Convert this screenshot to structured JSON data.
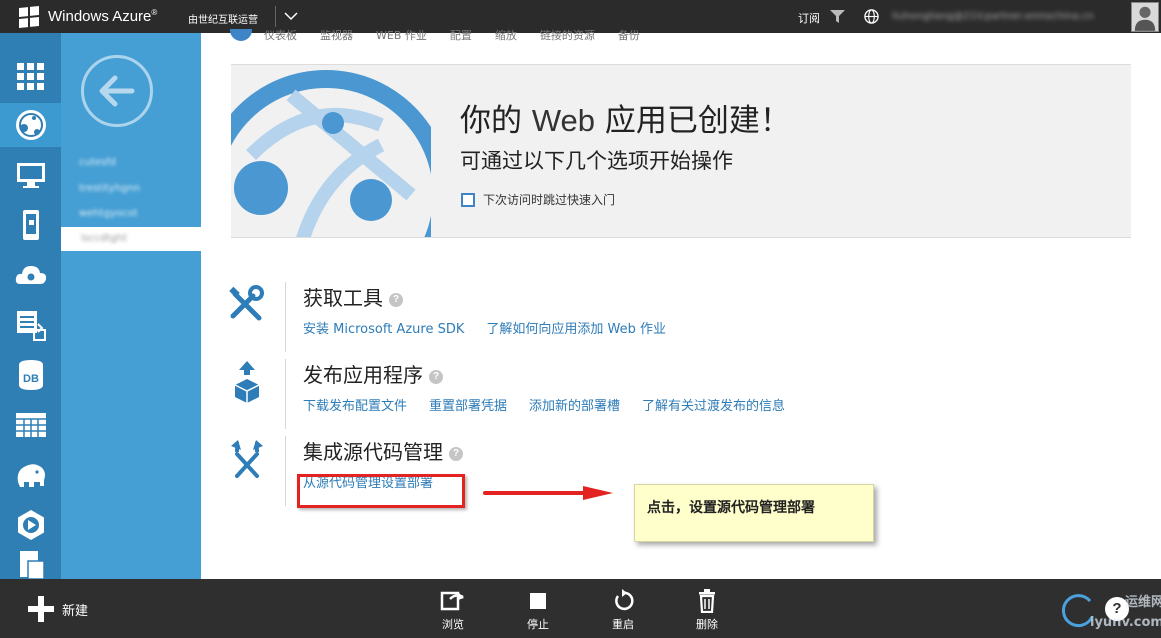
{
  "topbar": {
    "brand": "Windows Azure",
    "brand_mark": "®",
    "operator": "由世纪互联运营",
    "subscribe": "订阅",
    "account": "liuhongliang@21V.partner.onmschina.cn"
  },
  "leftnav": {
    "items": [
      {
        "icon": "all-items-grid-icon"
      },
      {
        "icon": "web-sites-icon",
        "active": true
      },
      {
        "icon": "virtual-machines-icon"
      },
      {
        "icon": "mobile-services-icon"
      },
      {
        "icon": "cloud-services-icon"
      },
      {
        "icon": "batch-service-icon"
      },
      {
        "icon": "sql-database-icon",
        "text": "DB"
      },
      {
        "icon": "storage-icon"
      },
      {
        "icon": "hdinsight-icon"
      },
      {
        "icon": "media-services-icon"
      },
      {
        "icon": "more-services-icon"
      }
    ]
  },
  "secnav": {
    "items": [
      "cutesfd",
      "trestityhgnn",
      "wehtgyocot"
    ],
    "selected": "lsccdtght"
  },
  "tabs": [
    "仪表板",
    "监视器",
    "WEB 作业",
    "配置",
    "缩放",
    "链接的资源",
    "备份"
  ],
  "hero": {
    "title_pre": "你的",
    "title_web": "Web",
    "title_post": "应用已创建！",
    "subtitle": "可通过以下几个选项开始操作",
    "skip_label": "下次访问时跳过快速入门"
  },
  "sections": [
    {
      "title": "获取工具",
      "icon": "tools-icon",
      "links": [
        "安装 Microsoft Azure SDK",
        "了解如何向应用添加 Web 作业"
      ]
    },
    {
      "title": "发布应用程序",
      "icon": "publish-icon",
      "links": [
        "下载发布配置文件",
        "重置部署凭据",
        "添加新的部署槽",
        "了解有关过渡发布的信息"
      ]
    },
    {
      "title": "集成源代码管理",
      "icon": "source-control-icon",
      "links": [
        "从源代码管理设置部署"
      ]
    }
  ],
  "help_glyph": "?",
  "annotation": {
    "note": "点击，设置源代码管理部署"
  },
  "bottombar": {
    "new_label": "新建",
    "commands": [
      {
        "label": "浏览",
        "icon": "browse-icon"
      },
      {
        "label": "停止",
        "icon": "stop-icon"
      },
      {
        "label": "重启",
        "icon": "restart-icon"
      },
      {
        "label": "删除",
        "icon": "delete-icon"
      }
    ],
    "help": "?",
    "watermark_top": "运维网",
    "watermark_bottom": "iyunv.com"
  },
  "colors": {
    "accent": "#2f7fb4",
    "secondary": "#469fd4",
    "link": "#2e7cb8",
    "annotation_red": "#e32222",
    "note_bg": "#ffffcc"
  }
}
